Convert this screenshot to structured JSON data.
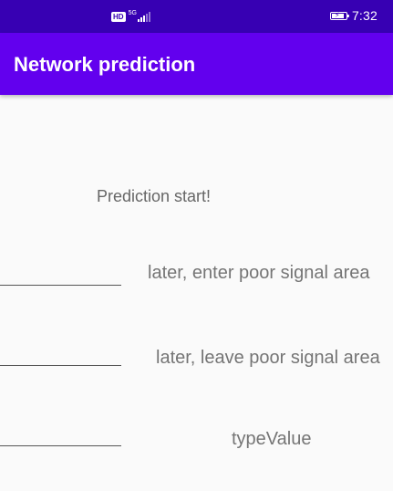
{
  "status_bar": {
    "hd_badge": "HD",
    "network_type": "5G",
    "time": "7:32"
  },
  "app_bar": {
    "title": "Network prediction"
  },
  "main": {
    "status_text": "Prediction start!",
    "rows": [
      {
        "input_value": "",
        "label": "later, enter poor signal area"
      },
      {
        "input_value": "",
        "label": "later, leave poor signal area"
      },
      {
        "input_value": "",
        "label": "typeValue"
      }
    ]
  },
  "colors": {
    "status_bar": "#3700b3",
    "app_bar": "#6200ee",
    "background": "#fafafa",
    "text_gray": "#757575"
  }
}
